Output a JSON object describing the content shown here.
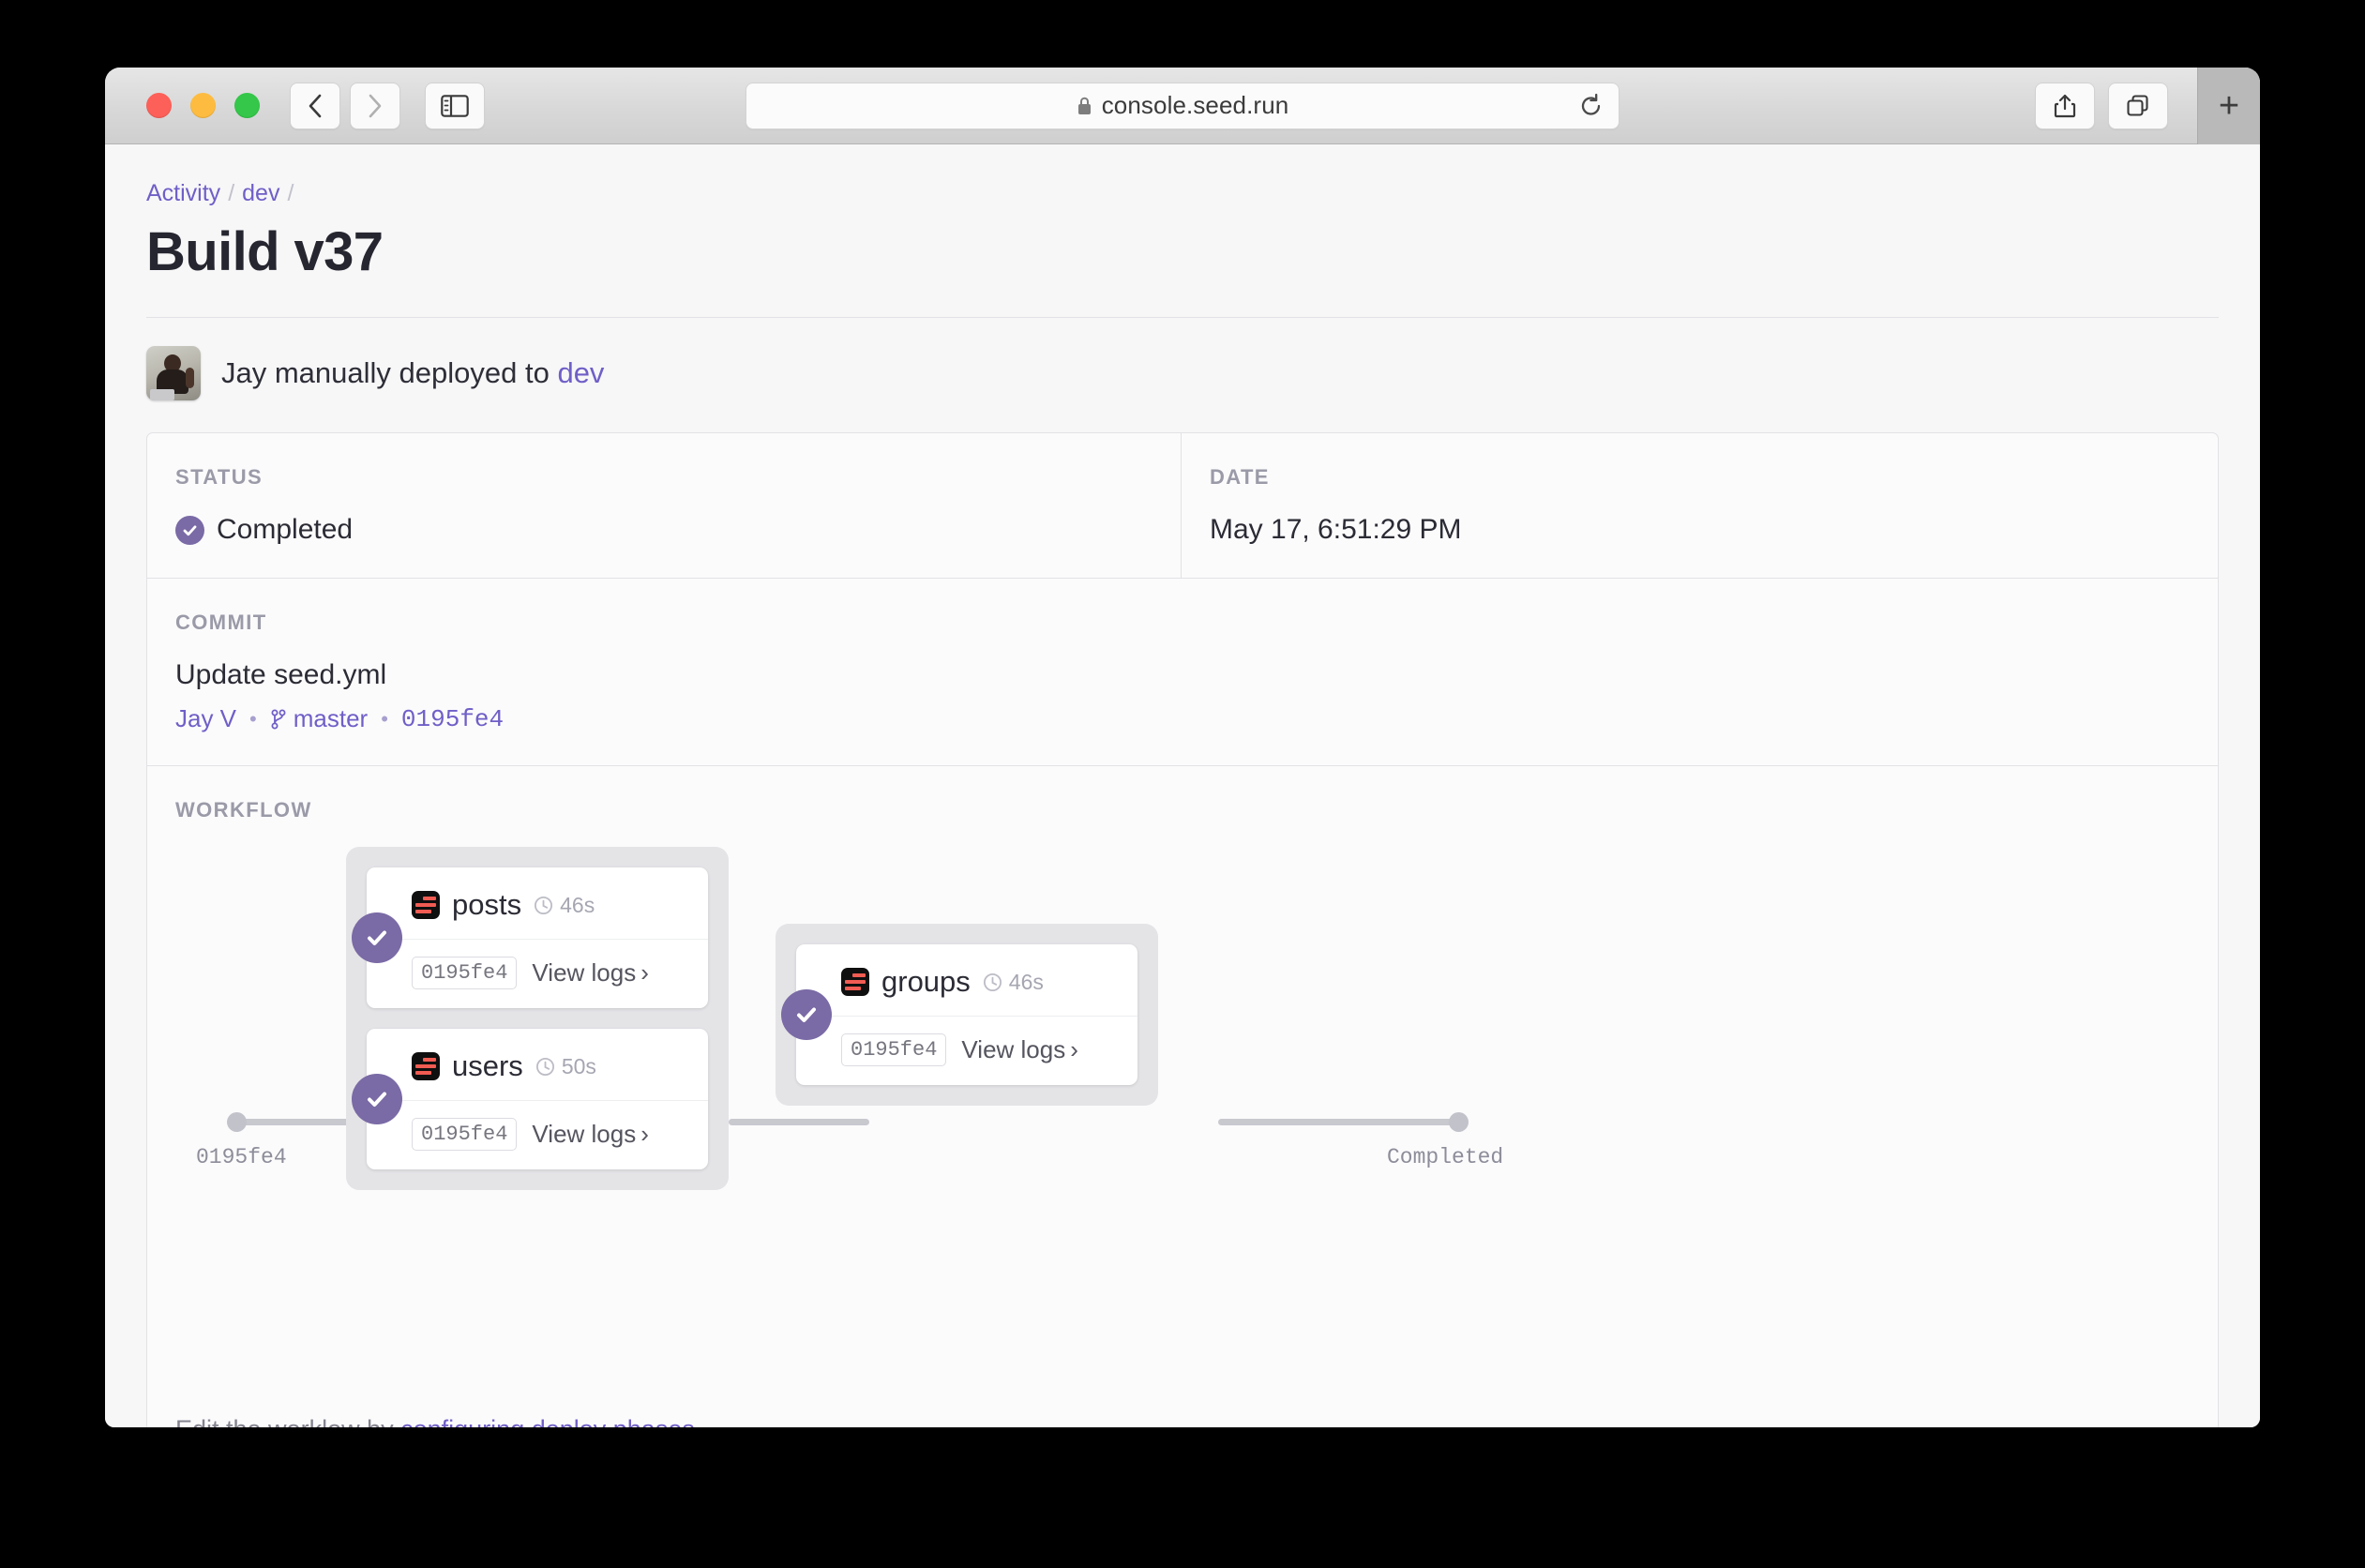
{
  "browser": {
    "url": "console.seed.run",
    "back_label": "Back",
    "forward_label": "Forward",
    "sidebar_label": "Show sidebar",
    "reload_label": "Reload",
    "share_label": "Share",
    "tabs_label": "Show tab overview",
    "newtab_label": "+"
  },
  "breadcrumb": {
    "items": [
      {
        "label": "Activity"
      },
      {
        "label": "dev"
      }
    ],
    "separator": "/"
  },
  "page": {
    "title": "Build v37",
    "deployed_text_before": "Jay manually deployed to",
    "deployed_stage": "dev"
  },
  "status": {
    "label": "STATUS",
    "value": "Completed"
  },
  "date": {
    "label": "DATE",
    "value": "May 17, 6:51:29 PM"
  },
  "commit": {
    "label": "COMMIT",
    "message": "Update seed.yml",
    "author": "Jay V",
    "branch": "master",
    "hash": "0195fe4",
    "separator": "•"
  },
  "workflow": {
    "label": "WORKFLOW",
    "start_node_label": "0195fe4",
    "end_node_label": "Completed",
    "phases": [
      {
        "jobs": [
          {
            "name": "posts",
            "duration": "46s",
            "hash": "0195fe4",
            "logs_label": "View logs",
            "logs_chevron": "›"
          },
          {
            "name": "users",
            "duration": "50s",
            "hash": "0195fe4",
            "logs_label": "View logs",
            "logs_chevron": "›"
          }
        ]
      },
      {
        "jobs": [
          {
            "name": "groups",
            "duration": "46s",
            "hash": "0195fe4",
            "logs_label": "View logs",
            "logs_chevron": "›"
          }
        ]
      }
    ],
    "footer_before": "Edit the worklow by",
    "footer_link": "configuring deploy phases",
    "footer_after": "."
  },
  "colors": {
    "accent_purple": "#6f5fc7",
    "status_purple": "#7a6aa5",
    "service_icon_bg": "#0f0f0f",
    "service_icon_bar": "#f05b52",
    "page_bg": "#f7f7f8"
  }
}
